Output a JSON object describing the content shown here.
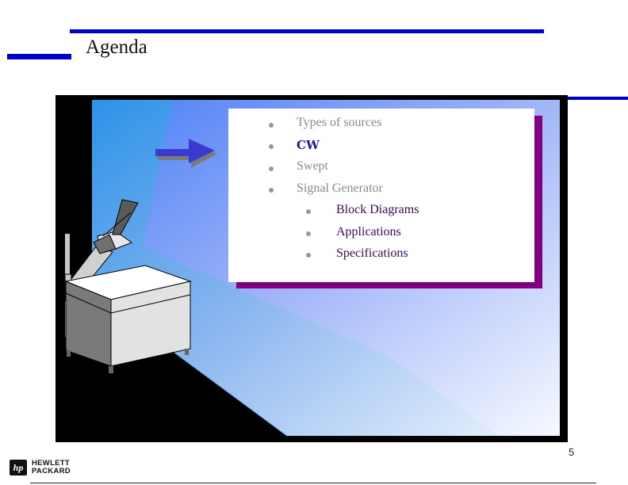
{
  "slide": {
    "title": "Agenda",
    "page_number": "5",
    "items": [
      {
        "label": "Types of sources",
        "state": "inactive",
        "level": 1
      },
      {
        "label": "CW",
        "state": "current",
        "level": 1
      },
      {
        "label": "Swept",
        "state": "inactive",
        "level": 1
      },
      {
        "label": "Signal Generator",
        "state": "inactive",
        "level": 1
      },
      {
        "label": "Block Diagrams",
        "state": "sub",
        "level": 2
      },
      {
        "label": "Applications",
        "state": "sub",
        "level": 2
      },
      {
        "label": "Specifications",
        "state": "sub",
        "level": 2
      }
    ]
  },
  "branding": {
    "logo_mark": "hp",
    "company_line1": "HEWLETT",
    "company_line2": "PACKARD"
  },
  "colors": {
    "accent_bar": "#0000cc",
    "shadow": "#800080",
    "current_item": "#1a1aa0",
    "sub_item": "#3a0a5a",
    "inactive_item": "#8a8a8a"
  },
  "icons": {
    "pointer": "right-arrow-icon",
    "projector": "overhead-projector-illustration"
  }
}
